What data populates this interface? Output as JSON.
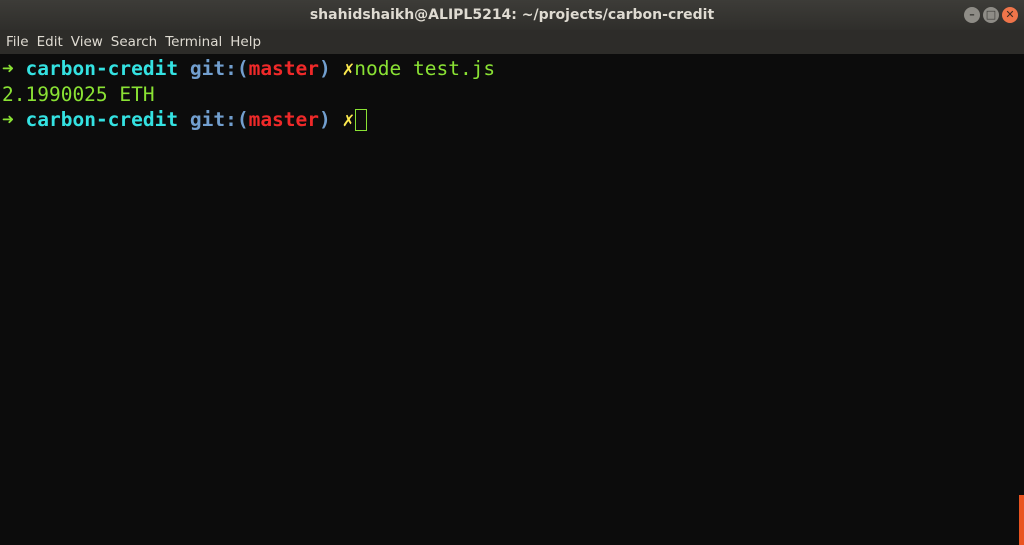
{
  "window": {
    "title": "shahidshaikh@ALIPL5214: ~/projects/carbon-credit",
    "buttons": {
      "minimize_glyph": "–",
      "maximize_glyph": "□",
      "close_glyph": "✕"
    }
  },
  "menu": {
    "items": [
      "File",
      "Edit",
      "View",
      "Search",
      "Terminal",
      "Help"
    ]
  },
  "terminal": {
    "prompt": {
      "arrow": "➜",
      "directory": "carbon-credit",
      "git_prefix": "git:(",
      "branch": "master",
      "git_suffix": ")",
      "dirty_marker": "✗"
    },
    "command": "node test.js",
    "output": "2.1990025 ETH"
  },
  "colors": {
    "background": "#0c0c0c",
    "prompt_arrow": "#8ae234",
    "directory": "#34e2e2",
    "git_label": "#729fcf",
    "branch": "#ef2929",
    "dirty_marker": "#fce94f",
    "command": "#8ae234",
    "scrollbar_accent": "#e95420"
  }
}
